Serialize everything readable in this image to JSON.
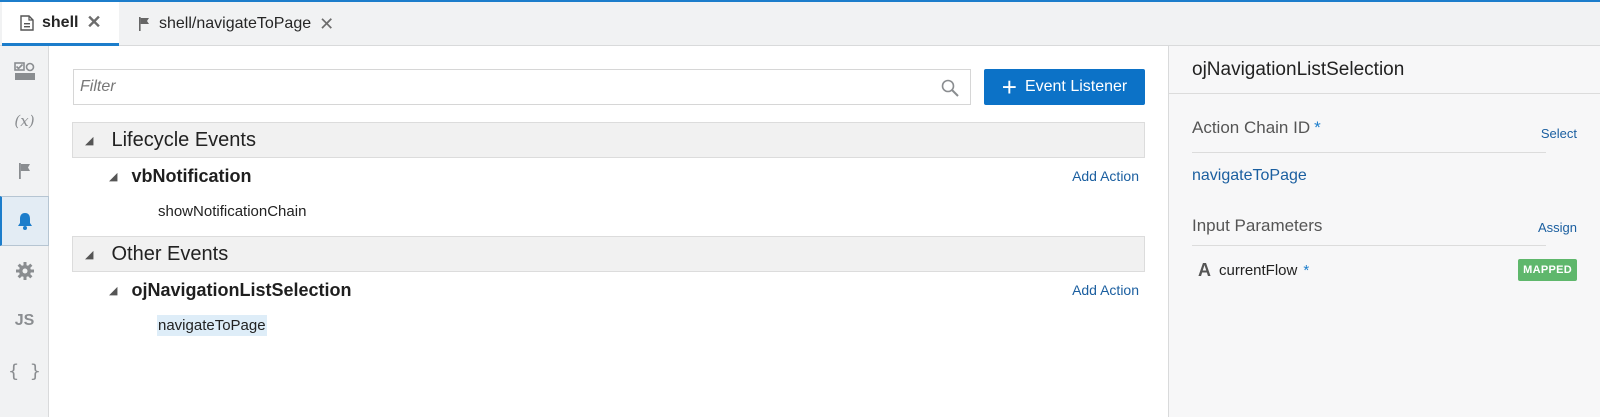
{
  "tabs": [
    {
      "label": "shell",
      "icon": "page-icon",
      "close": "✕"
    },
    {
      "label": "shell/navigateToPage",
      "icon": "flag-icon",
      "close": "✕"
    }
  ],
  "leftbar": {
    "items": [
      {
        "icon": "page-designer-icon"
      },
      {
        "icon": "variables-icon",
        "text": "(x)"
      },
      {
        "icon": "actions-flag-icon"
      },
      {
        "icon": "events-bell-icon"
      },
      {
        "icon": "settings-gear-icon"
      },
      {
        "icon": "javascript-icon",
        "text": "JS"
      },
      {
        "icon": "json-braces-icon",
        "text": "{ }"
      }
    ]
  },
  "main": {
    "filter_placeholder": "Filter",
    "event_listener_button": {
      "plus": "+",
      "label": "Event Listener"
    },
    "sections": [
      {
        "title": "Lifecycle Events",
        "event": "vbNotification",
        "add_action": "Add Action",
        "chain": "showNotificationChain"
      },
      {
        "title": "Other Events",
        "event": "ojNavigationListSelection",
        "add_action": "Add Action",
        "chain": "navigateToPage"
      }
    ]
  },
  "rightpanel": {
    "title": "ojNavigationListSelection",
    "action_chain_label": "Action Chain ID",
    "required_marker": "*",
    "select_link": "Select",
    "action_chain_value": "navigateToPage",
    "input_params_label": "Input Parameters",
    "assign_link": "Assign",
    "param": {
      "type_glyph": "A",
      "name": "currentFlow",
      "required": "*",
      "status": "MAPPED"
    }
  },
  "colors": {
    "accent": "#1c7dcb",
    "button": "#0c72c7",
    "link": "#1b5fa0",
    "mapped_badge": "#5fb76c"
  }
}
